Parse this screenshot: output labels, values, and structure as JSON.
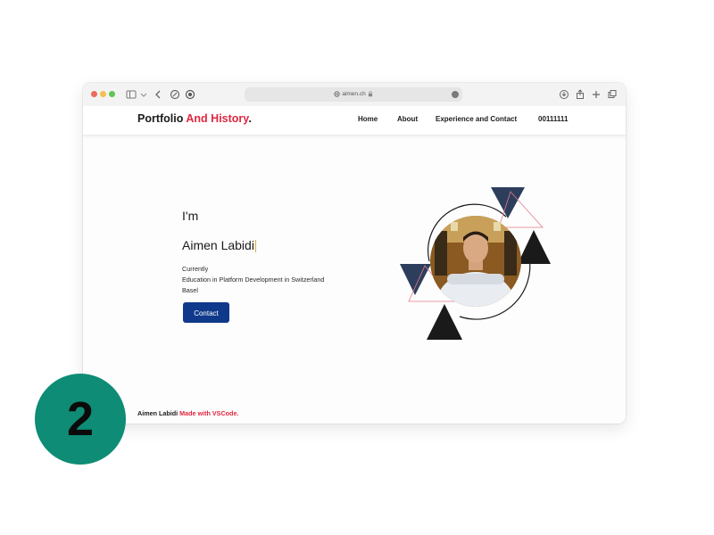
{
  "browser": {
    "url": "aimen.ch"
  },
  "site": {
    "brand_main": "Portfolio ",
    "brand_accent": "And History",
    "brand_dot": ".",
    "nav": [
      "Home",
      "About",
      "Experience and Contact",
      "00111111"
    ]
  },
  "hero": {
    "im": "I'm",
    "name": "Aimen Labidi",
    "lines": [
      "Currently",
      "Education in Platform Development in Switzerland",
      "Basel"
    ],
    "button": "Contact"
  },
  "footer": {
    "author": "Aimen Labidi",
    "made": "Made with VSCode."
  },
  "badge": {
    "number": "2"
  },
  "colors": {
    "accent": "#e0263f",
    "button": "#0f3a8b",
    "badge": "#0e8c75",
    "triangle_dark": "#1a1a1a",
    "triangle_navy": "#2d3e5c"
  }
}
